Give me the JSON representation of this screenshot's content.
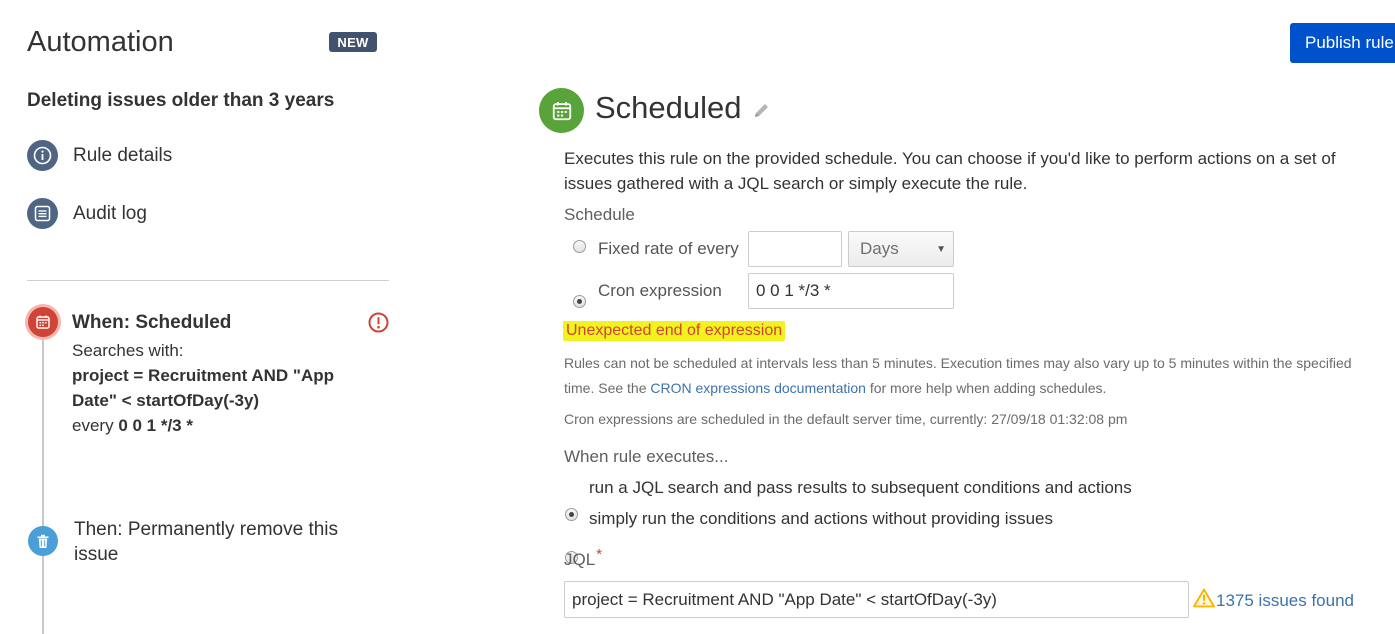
{
  "app": {
    "title": "Automation",
    "badge": "NEW"
  },
  "rule": {
    "name": "Deleting issues older than 3 years"
  },
  "nav": {
    "rule_details": "Rule details",
    "audit_log": "Audit log"
  },
  "trigger": {
    "title": "When: Scheduled",
    "searches_with": "Searches with:",
    "query": "project = Recruitment AND \"App Date\" < startOfDay(-3y)",
    "every_prefix": "every",
    "every_value": "0 0 1 */3 *"
  },
  "action": {
    "label": "Then: Permanently remove this issue"
  },
  "header": {
    "publish": "Publish rule"
  },
  "panel": {
    "title": "Scheduled",
    "description": "Executes this rule on the provided schedule. You can choose if you'd like to perform actions on a set of issues gathered with a JQL search or simply execute the rule.",
    "schedule_label": "Schedule",
    "fixed_rate_label": "Fixed rate of every",
    "fixed_rate_value": "",
    "unit_selected": "Days",
    "cron_label": "Cron expression",
    "cron_value": "0 0 1 */3 *",
    "selected_schedule": "cron",
    "error": "Unexpected end of expression",
    "help_before": "Rules can not be scheduled at intervals less than 5 minutes. Execution times may also vary up to 5 minutes within the specified time. See the",
    "help_link": "CRON expressions documentation",
    "help_after": "for more help when adding schedules.",
    "server_time": "Cron expressions are scheduled in the default server time, currently: 27/09/18 01:32:08 pm",
    "when_executes_label": "When rule executes...",
    "option_jql": "run a JQL search and pass results to subsequent conditions and actions",
    "option_simple": "simply run the conditions and actions without providing issues",
    "selected_execution": "jql",
    "jql_label": "JQL",
    "jql_required": "*",
    "jql_value": "project = Recruitment AND \"App Date\" < startOfDay(-3y)",
    "issues_found": "1375 issues found"
  },
  "colors": {
    "publish_bg": "#0052cc",
    "trigger_error": "#d04437",
    "schedule_green": "#59a43a",
    "nav_circle": "#506582",
    "action_blue": "#4a9fd9",
    "error_highlight": "#f2f21d",
    "link": "#3b73af"
  },
  "icons": {
    "rule_details": "info-icon",
    "audit_log": "list-icon",
    "trigger": "calendar-icon",
    "trigger_error": "error-icon",
    "action": "trash-icon",
    "schedule": "calendar-icon",
    "edit": "pencil-icon",
    "warning": "warning-icon"
  }
}
